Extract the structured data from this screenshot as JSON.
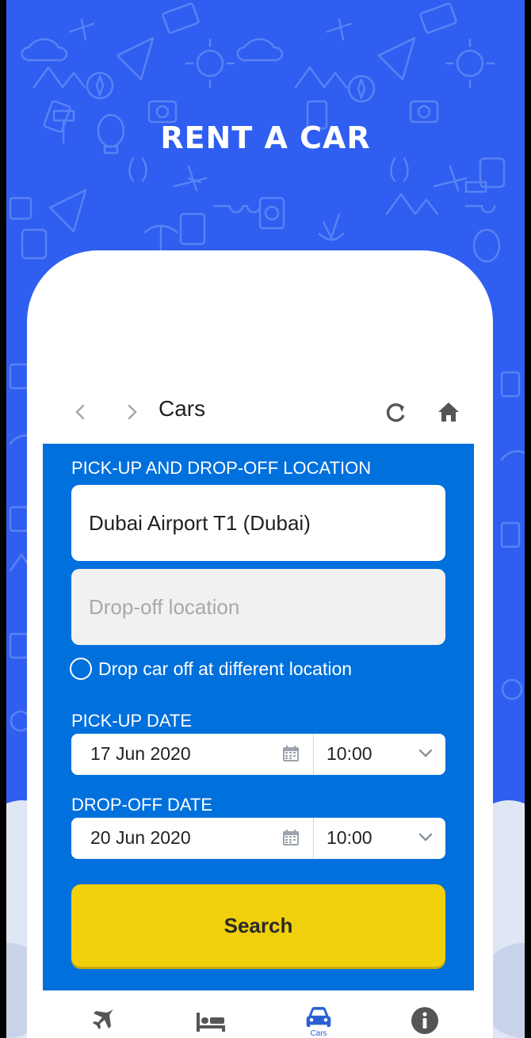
{
  "header": {
    "title": "RENT A CAR"
  },
  "nav": {
    "back_icon": "chevron-left-icon",
    "forward_icon": "chevron-right-icon",
    "title": "Cars",
    "refresh_icon": "refresh-icon",
    "home_icon": "home-icon"
  },
  "form": {
    "location_label": "PICK-UP AND DROP-OFF LOCATION",
    "pickup_location_value": "Dubai Airport T1 (Dubai)",
    "dropoff_location_placeholder": "Drop-off location",
    "different_location_label": "Drop car off at different location",
    "different_location_checked": false,
    "pickup_date_label": "PICK-UP DATE",
    "pickup_date": "17 Jun 2020",
    "pickup_time": "10:00",
    "dropoff_date_label": "DROP-OFF DATE",
    "dropoff_date": "20 Jun 2020",
    "dropoff_time": "10:00",
    "search_label": "Search"
  },
  "tabs": [
    {
      "icon": "airplane-icon",
      "label": ""
    },
    {
      "icon": "bed-icon",
      "label": ""
    },
    {
      "icon": "car-icon",
      "label": "Cars",
      "active": true
    },
    {
      "icon": "info-icon",
      "label": ""
    }
  ],
  "colors": {
    "background_blue": "#2f5ef0",
    "panel_blue": "#0070dc",
    "search_yellow": "#f0cf0b",
    "tab_active": "#2b5fd1"
  }
}
